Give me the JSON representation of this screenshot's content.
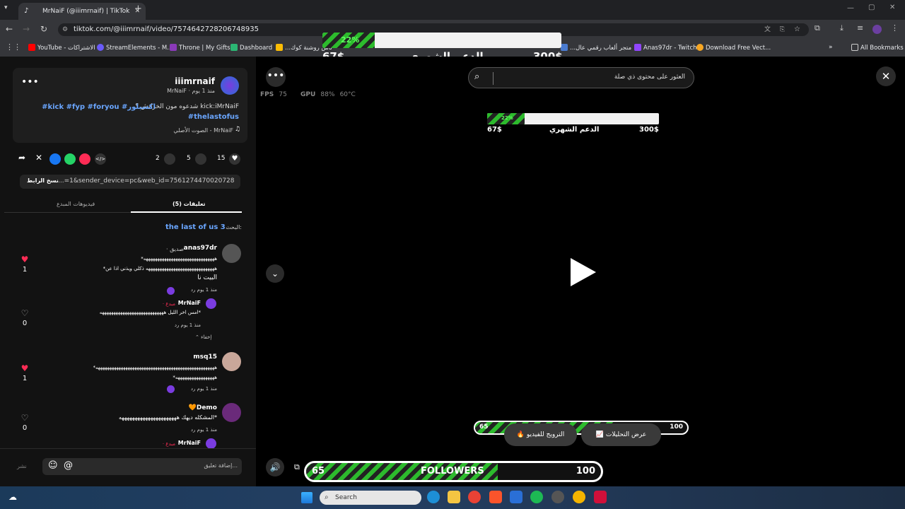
{
  "browser": {
    "tab_title": "MrNaiF (@iiimrnaif) | TikTok",
    "url": "tiktok.com/@iiimrnaif/video/7574642728206748935",
    "bookmarks": [
      "YouTube - الاشتراكات",
      "StreamElements - M...",
      "Throne | My Gifts",
      "Dashboard",
      "...ناش روشنة كوك",
      "...متجر ألعاب رقمي عال",
      "Anas97dr - Twitch",
      "Download Free Vect..."
    ],
    "all_bookmarks": "All Bookmarks"
  },
  "post": {
    "username": "iiimrnaif",
    "display_meta": "MrNaiF · منذ 1 يوم",
    "caption_line1": "شدعوه مون الخرابش ؟ kick:iMrNaiF",
    "caption_tags": "#kick #fyp #foryou #اكسبلور",
    "caption_tag2": "#thelastofus",
    "sound": "الصوت الأصلي - MrNaiF",
    "likes": "15",
    "comments": "5",
    "saves": "2",
    "link_text": "...=1&sender_device=pc&web_id=7561274470020728331",
    "copy_link": "نسخ الرابط",
    "tab_comments": "تعليقات (5)",
    "tab_creator_videos": "فيديوهات المبدع",
    "search_hint": "البحث:",
    "search_term": "the last of us 3"
  },
  "comments": [
    {
      "user": "anas97dr",
      "badge": "· صديق",
      "text1": "*هههههههههههههههههههههههههههههههه",
      "text2": "*ههههههههههههههههههههههههههههههه ذكلي ويذني اذا عن",
      "text3": "البيت نا",
      "meta": "منذ 1 يوم    رد",
      "likes": "1",
      "liked": true
    },
    {
      "user": "MrNaiF",
      "badge": "· مبدع",
      "text1": "امس اخر الليل ههههههههههههههههههههههههههههه*",
      "meta": "منذ 1 يوم    رد",
      "likes": "0",
      "liked": false
    },
    {
      "user": "msq15",
      "badge": "",
      "text1": "*ههههههههههههههههههههههههههههههههههههههههههههههههههههه",
      "text2": "*هههههههههههههههههه",
      "meta": "منذ 1 يوم    رد",
      "likes": "1",
      "liked": true
    },
    {
      "user": "Demo",
      "badge": "🧡",
      "text1": "المشكله ديهك ههههههههههههههههههههههه*",
      "meta": "منذ 1 يوم    رد",
      "likes": "0",
      "liked": false
    },
    {
      "user": "MrNaiF",
      "badge": "· مبدع",
      "text1": "",
      "meta": "",
      "likes": "",
      "liked": false
    }
  ],
  "hide_replies": "إخفاء",
  "comment_placeholder": "إضافة تعليق...",
  "post_button": "نشر",
  "video": {
    "search_placeholder": "العثور على محتوى ذي صلة",
    "fps_label": "FPS",
    "fps": "75",
    "gpu_label": "GPU",
    "gpu_pct": "88%",
    "gpu_temp": "60°C",
    "analytics": "عرض التحليلات",
    "promote": "الترويج للفيديو"
  },
  "goal": {
    "percent_label": "22%",
    "progress": 0.22,
    "title": "الدعم الشهري",
    "current": "67$",
    "target": "300$"
  },
  "followers": {
    "label": "FOLLOWERS",
    "current": "65",
    "target": "100",
    "progress": 0.65
  },
  "taskbar": {
    "search": "Search"
  },
  "colors": {
    "accent_green": "#2dbb2d",
    "like_red": "#fe2c55",
    "link_blue": "#6aa6ff"
  }
}
